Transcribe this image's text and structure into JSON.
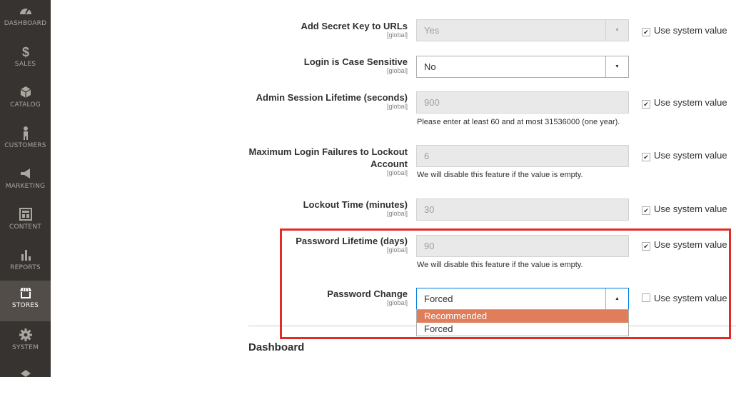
{
  "sidebar": {
    "items": [
      {
        "label": "DASHBOARD",
        "icon": "dashboard-icon"
      },
      {
        "label": "SALES",
        "icon": "dollar-icon"
      },
      {
        "label": "CATALOG",
        "icon": "cube-icon"
      },
      {
        "label": "CUSTOMERS",
        "icon": "person-icon"
      },
      {
        "label": "MARKETING",
        "icon": "megaphone-icon"
      },
      {
        "label": "CONTENT",
        "icon": "layout-icon"
      },
      {
        "label": "REPORTS",
        "icon": "bar-chart-icon"
      },
      {
        "label": "STORES",
        "icon": "store-icon"
      },
      {
        "label": "SYSTEM",
        "icon": "gear-icon"
      },
      {
        "label": "",
        "icon": "partners-icon"
      }
    ],
    "active": "STORES"
  },
  "form": {
    "secret_key": {
      "label": "Add Secret Key to URLs",
      "scope": "[global]",
      "value": "Yes",
      "use_system": "Use system value",
      "use_system_checked": true
    },
    "case_sensitive": {
      "label": "Login is Case Sensitive",
      "scope": "[global]",
      "value": "No"
    },
    "session_lifetime": {
      "label": "Admin Session Lifetime (seconds)",
      "scope": "[global]",
      "value": "900",
      "note": "Please enter at least 60 and at most 31536000 (one year).",
      "use_system": "Use system value",
      "use_system_checked": true
    },
    "max_failures": {
      "label_line1": "Maximum Login Failures to Lockout",
      "label_line2": "Account",
      "scope": "[global]",
      "value": "6",
      "note": "We will disable this feature if the value is empty.",
      "use_system": "Use system value",
      "use_system_checked": true
    },
    "lockout_time": {
      "label": "Lockout Time (minutes)",
      "scope": "[global]",
      "value": "30",
      "use_system": "Use system value",
      "use_system_checked": true
    },
    "password_lifetime": {
      "label": "Password Lifetime (days)",
      "scope": "[global]",
      "value": "90",
      "note": "We will disable this feature if the value is empty.",
      "use_system": "Use system value",
      "use_system_checked": true
    },
    "password_change": {
      "label": "Password Change",
      "scope": "[global]",
      "value": "Forced",
      "use_system": "Use system value",
      "use_system_checked": false,
      "options": [
        "Recommended",
        "Forced"
      ],
      "highlighted_option": "Recommended"
    }
  },
  "section": {
    "title": "Dashboard"
  },
  "colors": {
    "sidebar_bg": "#373330",
    "active_nav": "#524d49",
    "highlight_border": "#e02b27",
    "option_highlight": "#e07d5a"
  }
}
